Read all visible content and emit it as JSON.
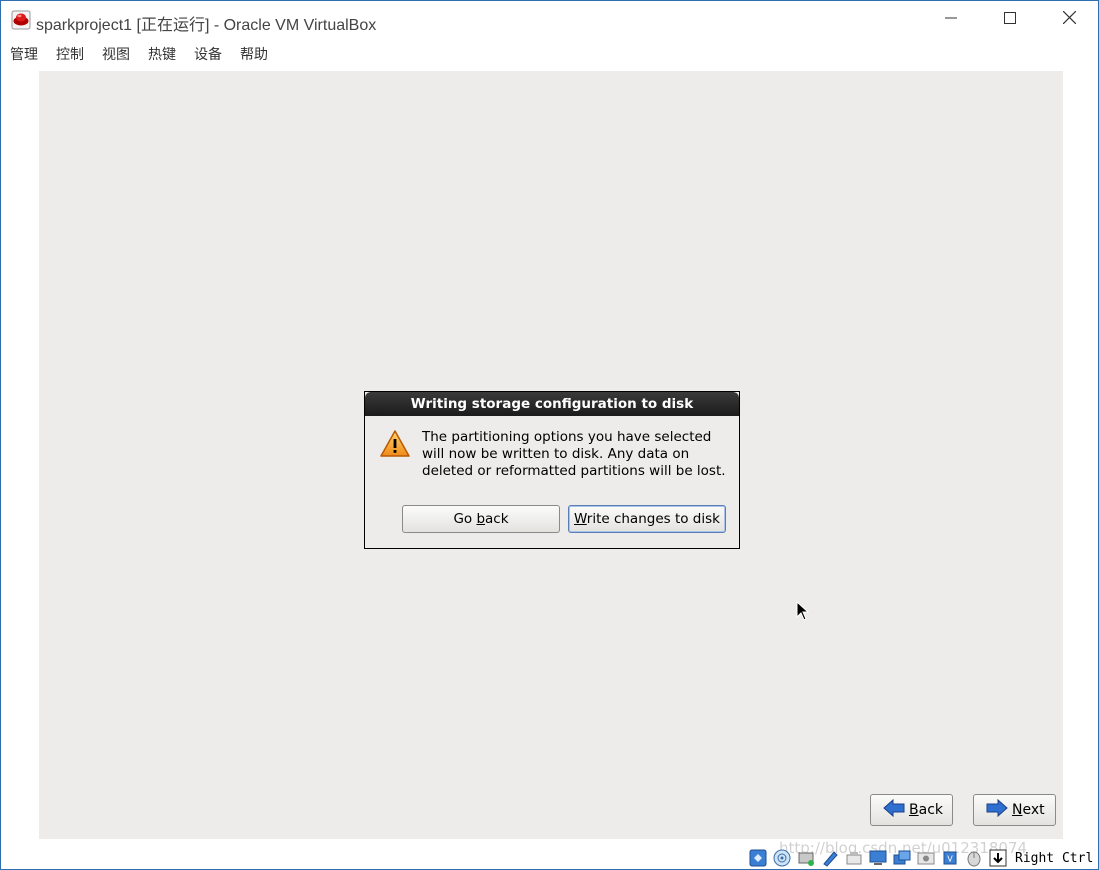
{
  "window": {
    "title": "sparkproject1 [正在运行] - Oracle VM VirtualBox",
    "app_icon": "virtualbox-vm-icon",
    "controls": [
      "minimize-icon",
      "maximize-icon",
      "close-icon"
    ]
  },
  "menu": {
    "items": [
      "管理",
      "控制",
      "视图",
      "热键",
      "设备",
      "帮助"
    ]
  },
  "dialog": {
    "title": "Writing storage configuration to disk",
    "icon": "warning-icon",
    "message": "The partitioning options you have selected will now be written to disk.  Any data on deleted or reformatted partitions will be lost.",
    "go_back": {
      "pre": "Go ",
      "mnemonic": "b",
      "post": "ack"
    },
    "write": {
      "pre": "",
      "mnemonic": "W",
      "post": "rite changes to disk"
    }
  },
  "installer_nav": {
    "back": {
      "mnemonic": "B",
      "post": "ack",
      "icon": "arrow-left-icon"
    },
    "next": {
      "mnemonic": "N",
      "post": "ext",
      "icon": "arrow-right-icon"
    }
  },
  "status_bar": {
    "icons": [
      "hard-disk-icon",
      "optical-drive-icon",
      "audio-icon",
      "network-icon",
      "usb-icon",
      "shared-folders-icon",
      "display-icon",
      "video-capture-icon",
      "cpu-icon",
      "mouse-integration-icon",
      "keyboard-capture-icon"
    ],
    "host_key": "Right Ctrl"
  },
  "watermark": "http://blog.csdn.net/u012318074",
  "colors": {
    "guest_background": "#edecea",
    "dialog_header": "#1b1b1b",
    "window_border": "#2f6fb0"
  }
}
